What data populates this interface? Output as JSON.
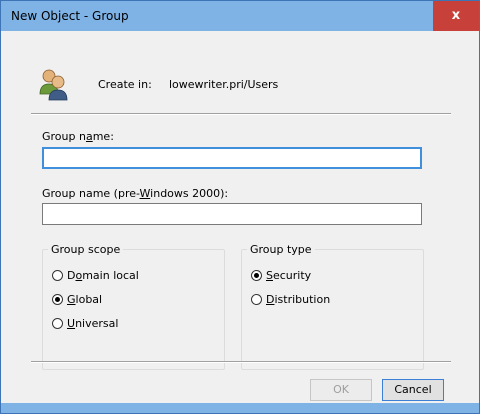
{
  "window": {
    "title": "New Object - Group",
    "close_glyph": "x"
  },
  "header": {
    "icon": "group-users-icon",
    "create_in_label": "Create in:",
    "create_in_path": "lowewriter.pri/Users"
  },
  "form": {
    "group_name": {
      "label_before": "Group n",
      "label_accel": "a",
      "label_after": "me:",
      "value": ""
    },
    "pre2000_name": {
      "label_before": "Group name (pre-",
      "label_accel": "W",
      "label_after": "indows 2000):",
      "value": ""
    }
  },
  "group_scope": {
    "legend": "Group scope",
    "options": [
      {
        "before": "D",
        "accel": "o",
        "after": "main local",
        "selected": false
      },
      {
        "before": "",
        "accel": "G",
        "after": "lobal",
        "selected": true
      },
      {
        "before": "",
        "accel": "U",
        "after": "niversal",
        "selected": false
      }
    ]
  },
  "group_type": {
    "legend": "Group type",
    "options": [
      {
        "before": "",
        "accel": "S",
        "after": "ecurity",
        "selected": true
      },
      {
        "before": "",
        "accel": "D",
        "after": "istribution",
        "selected": false
      }
    ]
  },
  "buttons": {
    "ok": "OK",
    "cancel": "Cancel"
  },
  "colors": {
    "titlebar": "#7fb2e5",
    "close": "#c7413a",
    "focus": "#3f8fdc"
  }
}
